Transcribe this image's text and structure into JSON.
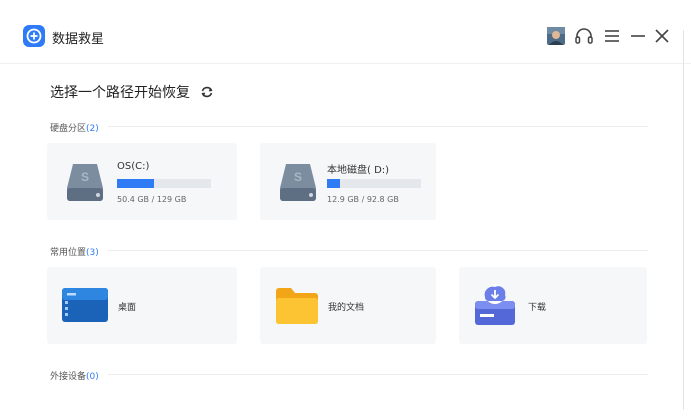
{
  "app": {
    "title": "数据救星"
  },
  "colors": {
    "accent": "#2f7bf5",
    "card_bg": "#f6f7f9",
    "bar_track": "#e4e7ec"
  },
  "icons": {
    "logo": "lifebuoy-icon",
    "avatar": "user-avatar",
    "support": "headset-icon",
    "menu": "menu-icon",
    "minimize": "minimize-icon",
    "close": "close-icon",
    "refresh": "refresh-icon"
  },
  "heading": "选择一个路径开始恢复",
  "groups": {
    "drives": {
      "label": "硬盘分区",
      "count": "(2)"
    },
    "locations": {
      "label": "常用位置",
      "count": "(3)"
    },
    "external": {
      "label": "外接设备",
      "count": "(0)"
    }
  },
  "drives": [
    {
      "name": "OS(C:)",
      "size": "50.4 GB / 129 GB",
      "used_fraction": 0.39
    },
    {
      "name": "本地磁盘( D:)",
      "size": "12.9 GB / 92.8 GB",
      "used_fraction": 0.14
    }
  ],
  "locations": [
    {
      "label": "桌面",
      "icon": "desktop-icon"
    },
    {
      "label": "我的文档",
      "icon": "folder-icon"
    },
    {
      "label": "下载",
      "icon": "download-icon"
    }
  ]
}
